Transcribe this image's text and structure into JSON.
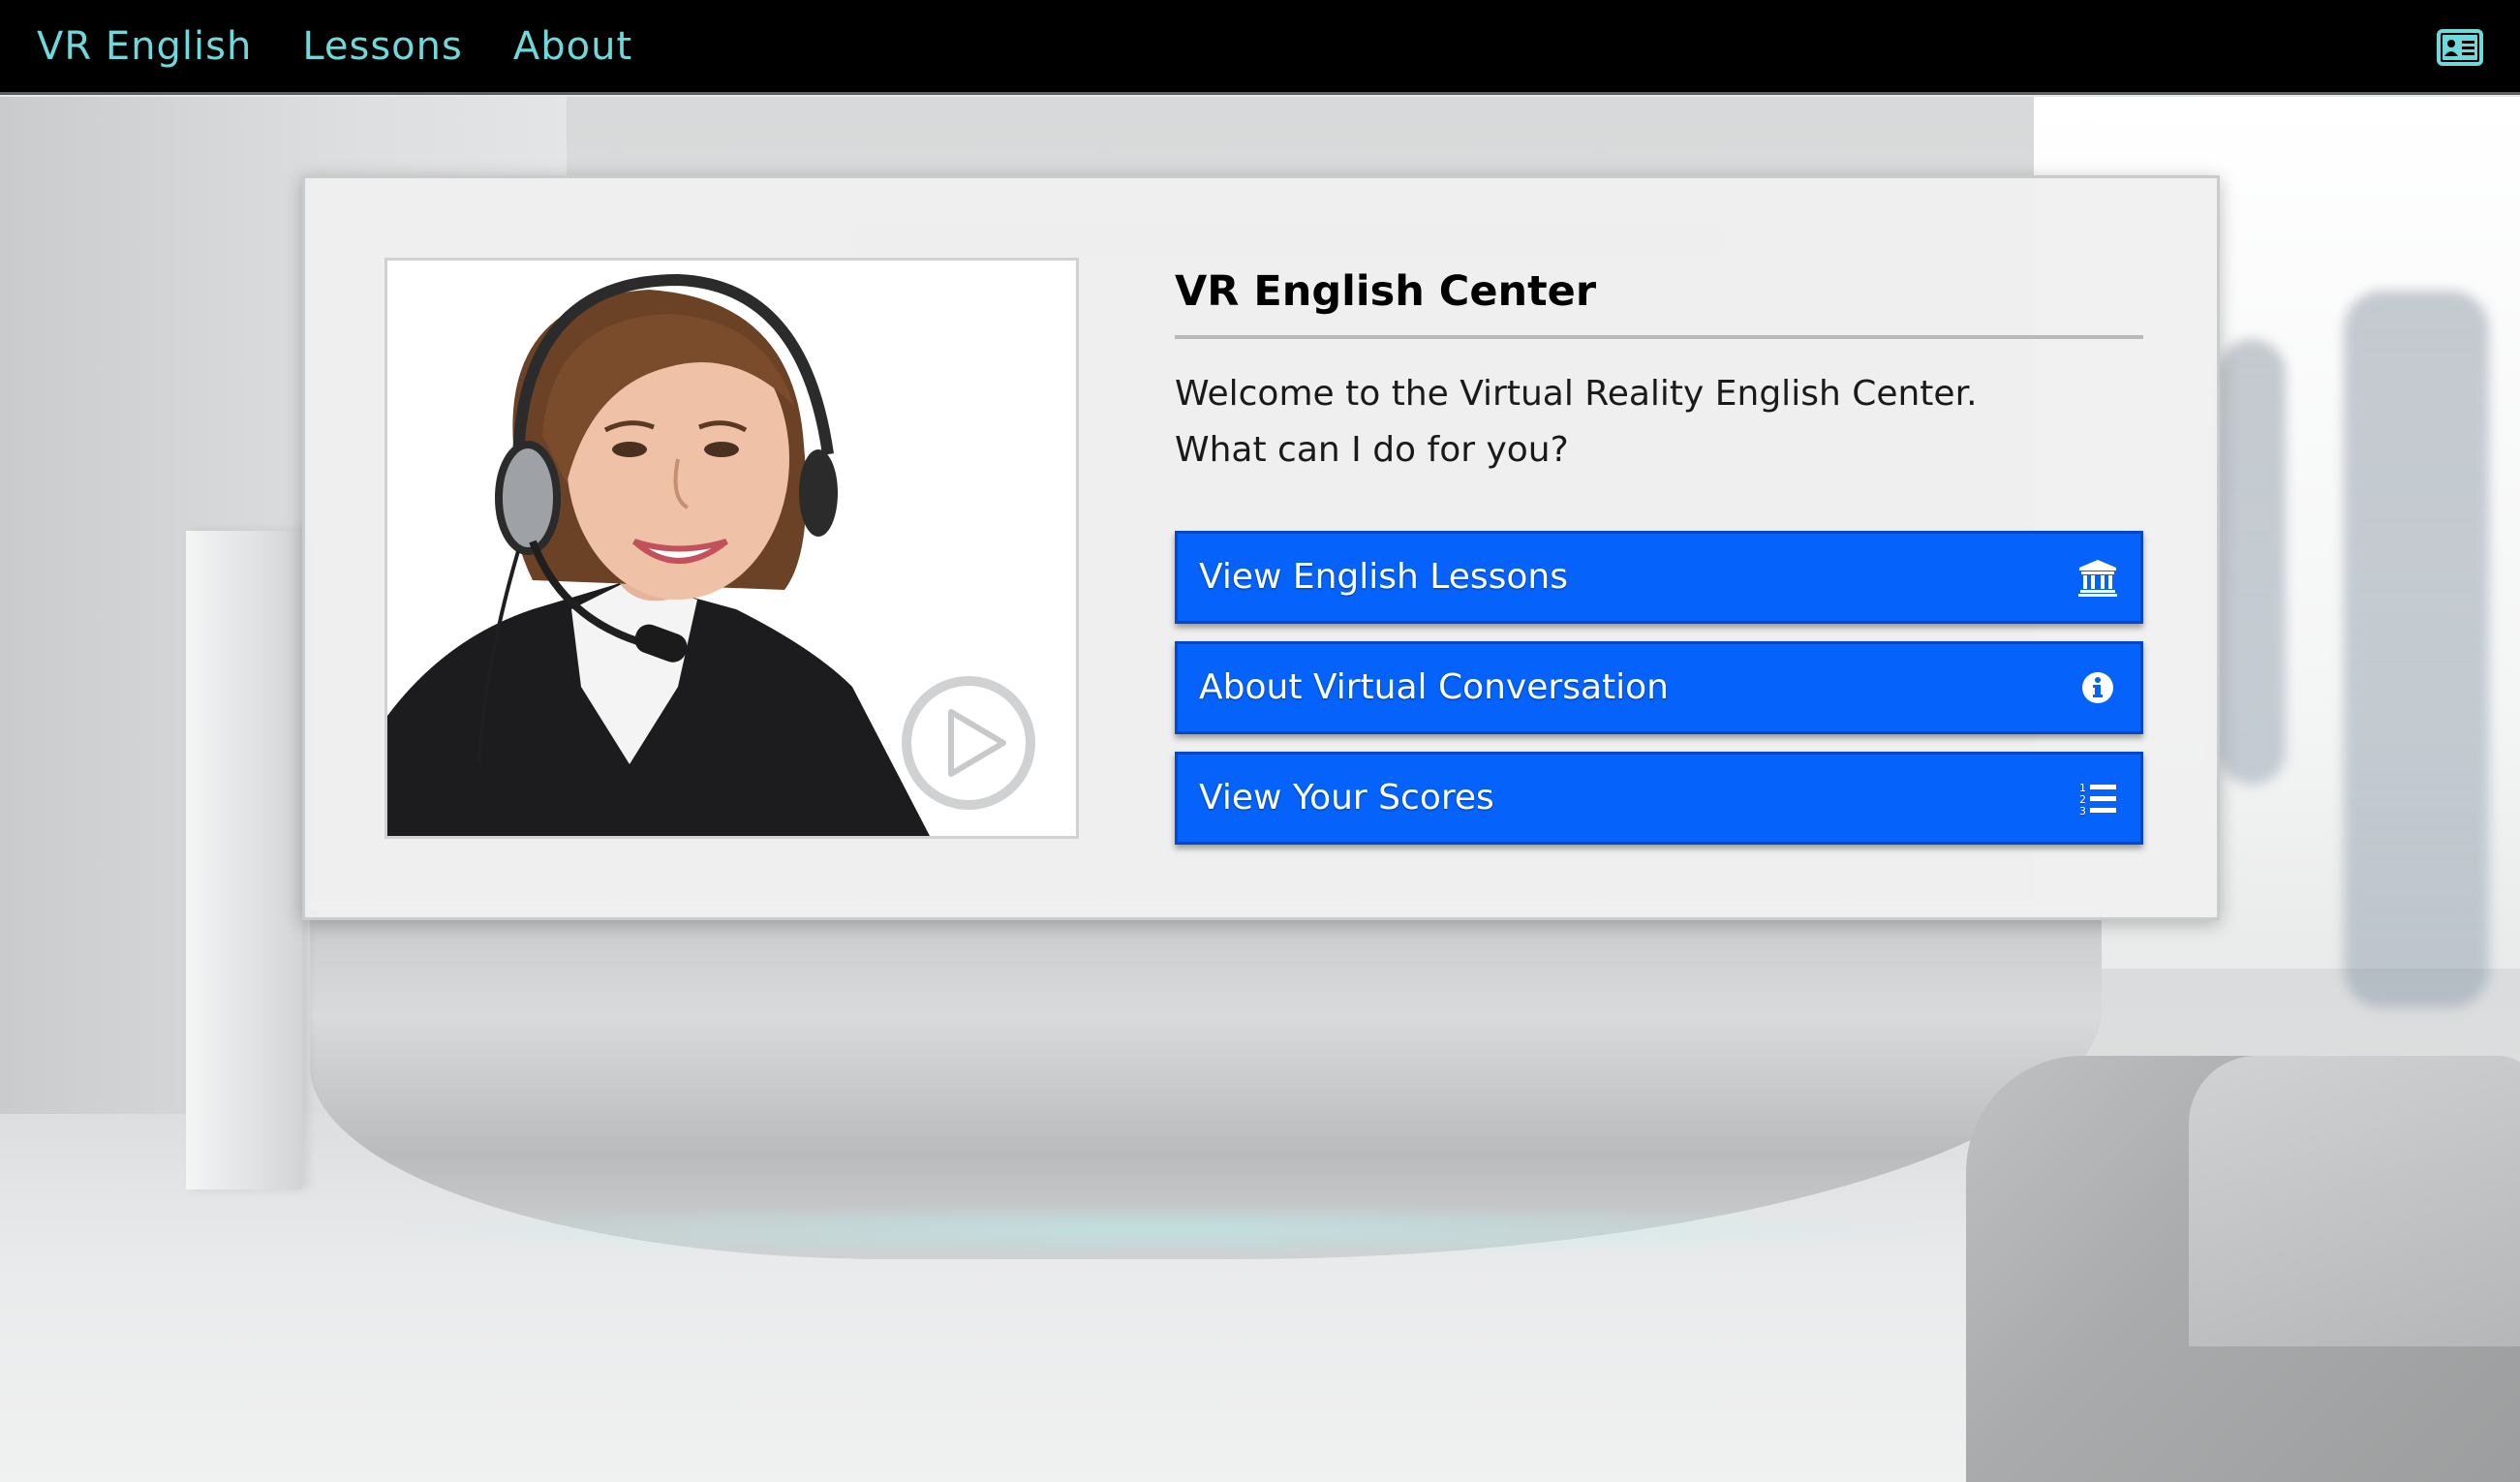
{
  "navbar": {
    "brand": "VR English",
    "links": [
      {
        "label": "Lessons"
      },
      {
        "label": "About"
      }
    ],
    "profile_icon": "id-card-icon"
  },
  "panel": {
    "media": {
      "subject": "customer-service-agent-with-headset",
      "play_icon": "play-circle-icon"
    },
    "title": "VR English Center",
    "welcome_line1": "Welcome to the Virtual Reality English Center.",
    "welcome_line2": "What can I do for you?",
    "actions": [
      {
        "label": "View English Lessons",
        "icon": "university-icon"
      },
      {
        "label": "About Virtual Conversation",
        "icon": "info-circle-icon"
      },
      {
        "label": "View Your Scores",
        "icon": "list-ol-icon"
      }
    ]
  },
  "colors": {
    "navbar_bg": "#000000",
    "nav_text": "#6fd8db",
    "button_bg": "#0563fb",
    "panel_bg": "#f0f0f0"
  }
}
